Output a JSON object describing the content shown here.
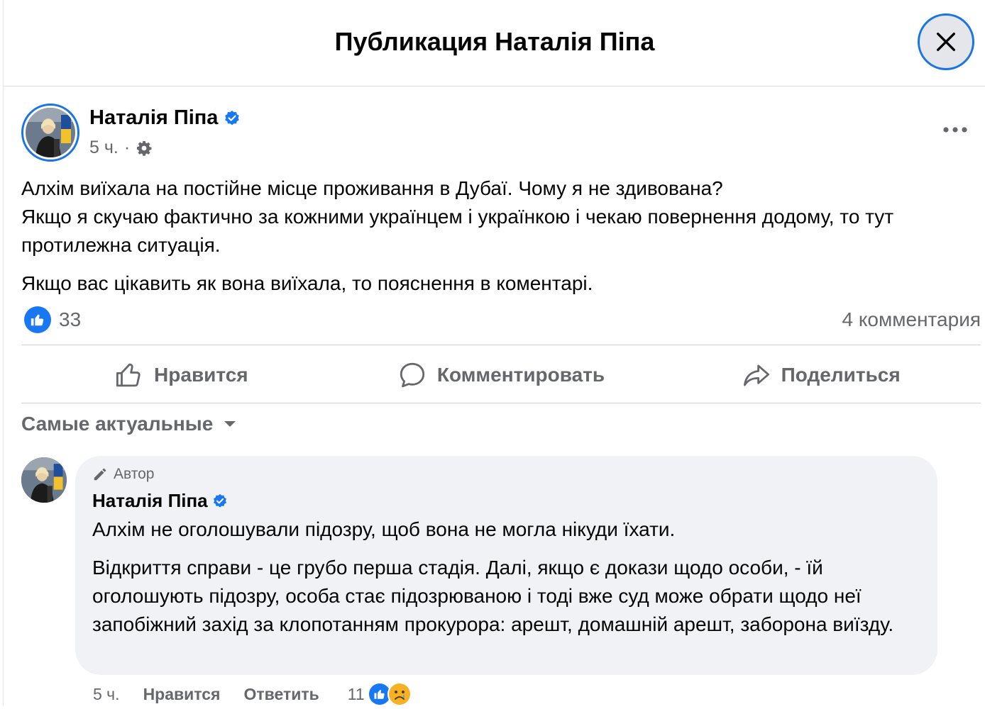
{
  "header": {
    "title": "Публикация Наталія Піпа"
  },
  "post": {
    "author": "Наталія Піпа",
    "time": "5 ч.",
    "separator": "·",
    "paragraphs": [
      "Алхім виїхала на постійне місце проживання в Дубаї. Чому я не здивована?\nЯкщо я скучаю фактично за кожними українцем і українкою і чекаю повернення додому, то тут протилежна ситуація.",
      "Якщо вас цікавить як вона виїхала, то пояснення в коментарі."
    ],
    "likes": "33",
    "comments_count": "4 комментария"
  },
  "actions": {
    "like": "Нравится",
    "comment": "Комментировать",
    "share": "Поделиться"
  },
  "sort": {
    "label": "Самые актуальные"
  },
  "comment": {
    "author_tag": "Автор",
    "author": "Наталія Піпа",
    "paragraphs": [
      "Алхім не оголошували підозру, щоб вона не могла нікуди їхати.",
      "Відкриття справи - це грубо перша стадія. Далі, якщо є докази щодо особи, - їй оголошують підозру, особа стає підозрюваною і тоді вже суд може обрати щодо неї запобіжний захід за клопотанням прокурора: арешт, домашній арешт, заборона виїзду."
    ],
    "time": "5 ч.",
    "like": "Нравится",
    "reply": "Ответить",
    "reactions_count": "11"
  },
  "colors": {
    "accent": "#1877f2",
    "secondary_text": "#65676b",
    "bubble": "#f0f2f5"
  },
  "icons": [
    "close-icon",
    "verified-icon",
    "gear-icon",
    "more-icon",
    "like-icon",
    "comment-icon",
    "share-icon",
    "caret-down-icon",
    "pencil-icon",
    "sad-icon"
  ]
}
